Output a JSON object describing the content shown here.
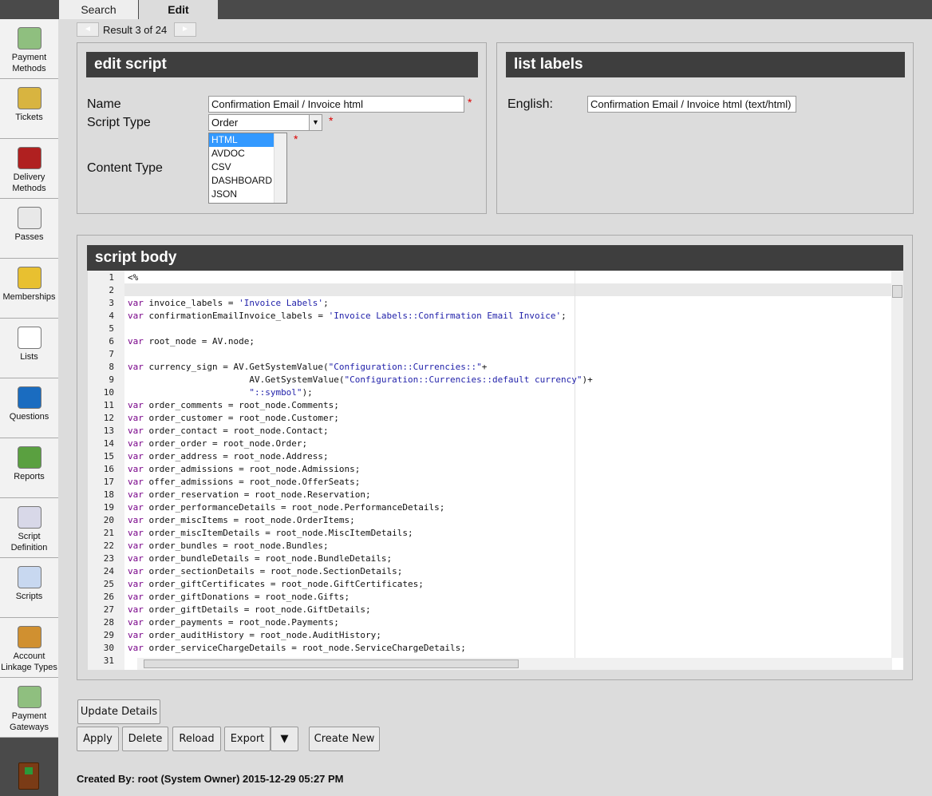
{
  "tabs": {
    "search": "Search",
    "edit": "Edit"
  },
  "nav": {
    "result": "Result 3 of 24",
    "prev": "◄",
    "next": "►"
  },
  "sidebar": {
    "items": [
      {
        "label": "Payment Methods",
        "icon": "money-icon",
        "color": "#8fbf7f"
      },
      {
        "label": "Tickets",
        "icon": "ticket-icon",
        "color": "#d8b440"
      },
      {
        "label": "Delivery Methods",
        "icon": "mailbox-icon",
        "color": "#b02020"
      },
      {
        "label": "Passes",
        "icon": "pass-icon",
        "color": "#e8e8e8"
      },
      {
        "label": "Memberships",
        "icon": "badge-icon",
        "color": "#e8c030"
      },
      {
        "label": "Lists",
        "icon": "list-icon",
        "color": "#ffffff"
      },
      {
        "label": "Questions",
        "icon": "question-icon",
        "color": "#1a6cc0"
      },
      {
        "label": "Reports",
        "icon": "report-icon",
        "color": "#5aa040"
      },
      {
        "label": "Script Definition",
        "icon": "script-definition-icon",
        "color": "#d8d8e8"
      },
      {
        "label": "Scripts",
        "icon": "scripts-icon",
        "color": "#c8d8f0"
      },
      {
        "label": "Account Linkage Types",
        "icon": "linkage-icon",
        "color": "#d09030"
      },
      {
        "label": "Payment Gateways",
        "icon": "money-icon",
        "color": "#8fbf7f"
      }
    ]
  },
  "edit_script": {
    "title": "edit script",
    "name_label": "Name",
    "name_value": "Confirmation Email / Invoice html",
    "type_label": "Script Type",
    "type_value": "Order",
    "content_label": "Content Type",
    "content_options": [
      "HTML",
      "AVDOC",
      "CSV",
      "DASHBOARD",
      "JSON"
    ],
    "content_selected": "HTML",
    "required": "*"
  },
  "list_labels": {
    "title": "list labels",
    "english_label": "English:",
    "english_value": "Confirmation Email / Invoice html (text/html)"
  },
  "script_body": {
    "title": "script body",
    "lines": [
      "<%",
      "",
      "var invoice_labels = 'Invoice Labels';",
      "var confirmationEmailInvoice_labels = 'Invoice Labels::Confirmation Email Invoice';",
      "",
      "var root_node = AV.node;",
      "",
      "var currency_sign = AV.GetSystemValue(\"Configuration::Currencies::\"+",
      "                       AV.GetSystemValue(\"Configuration::Currencies::default currency\")+",
      "                       \"::symbol\");",
      "var order_comments = root_node.Comments;",
      "var order_customer = root_node.Customer;",
      "var order_contact = root_node.Contact;",
      "var order_order = root_node.Order;",
      "var order_address = root_node.Address;",
      "var order_admissions = root_node.Admissions;",
      "var offer_admissions = root_node.OfferSeats;",
      "var order_reservation = root_node.Reservation;",
      "var order_performanceDetails = root_node.PerformanceDetails;",
      "var order_miscItems = root_node.OrderItems;",
      "var order_miscItemDetails = root_node.MiscItemDetails;",
      "var order_bundles = root_node.Bundles;",
      "var order_bundleDetails = root_node.BundleDetails;",
      "var order_sectionDetails = root_node.SectionDetails;",
      "var order_giftCertificates = root_node.GiftCertificates;",
      "var order_giftDonations = root_node.Gifts;",
      "var order_giftDetails = root_node.GiftDetails;",
      "var order_payments = root_node.Payments;",
      "var order_auditHistory = root_node.AuditHistory;",
      "var order_serviceChargeDetails = root_node.ServiceChargeDetails;",
      ""
    ]
  },
  "buttons": {
    "update": "Update Details",
    "apply": "Apply",
    "delete": "Delete",
    "reload": "Reload",
    "export": "Export",
    "export_menu": "▼",
    "create_new": "Create New"
  },
  "footer": {
    "created_by": "Created By: root (System Owner) 2015-12-29 05:27 PM"
  }
}
